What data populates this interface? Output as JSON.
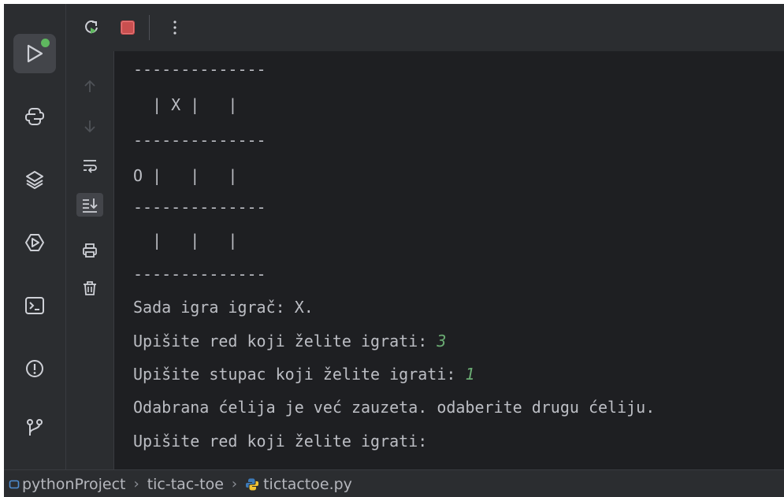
{
  "toolbar": {
    "rerun_icon": "rerun-icon",
    "stop_icon": "stop-icon",
    "more_icon": "more-vertical-icon"
  },
  "left_sidebar": [
    {
      "name": "run-tool-icon",
      "active": true
    },
    {
      "name": "python-console-icon"
    },
    {
      "name": "layers-icon"
    },
    {
      "name": "services-icon"
    },
    {
      "name": "terminal-icon"
    },
    {
      "name": "problems-icon"
    },
    {
      "name": "git-icon"
    }
  ],
  "console_tools": [
    "arrow-up-icon",
    "arrow-down-icon",
    "soft-wrap-icon",
    "scroll-to-end-icon",
    "print-icon",
    "trash-icon"
  ],
  "console": {
    "lines": [
      {
        "text": "--------------"
      },
      {
        "text": "  | X |   |"
      },
      {
        "text": "--------------"
      },
      {
        "text": "O |   |   |"
      },
      {
        "text": "--------------"
      },
      {
        "text": "  |   |   |"
      },
      {
        "text": "--------------"
      },
      {
        "text": "Sada igra igrač: X."
      },
      {
        "text": "Upišite red koji želite igrati: ",
        "input": "3"
      },
      {
        "text": "Upišite stupac koji želite igrati: ",
        "input": "1"
      },
      {
        "text": "Odabrana ćelija je već zauzeta. odaberite drugu ćeliju."
      },
      {
        "text": "Upišite red koji želite igrati:"
      }
    ]
  },
  "breadcrumb": {
    "project": "pythonProject",
    "folder": "tic-tac-toe",
    "file": "tictactoe.py"
  },
  "colors": {
    "accent_green": "#5fb85f",
    "input_green": "#6aab73",
    "stop_red": "#c94f4f"
  }
}
